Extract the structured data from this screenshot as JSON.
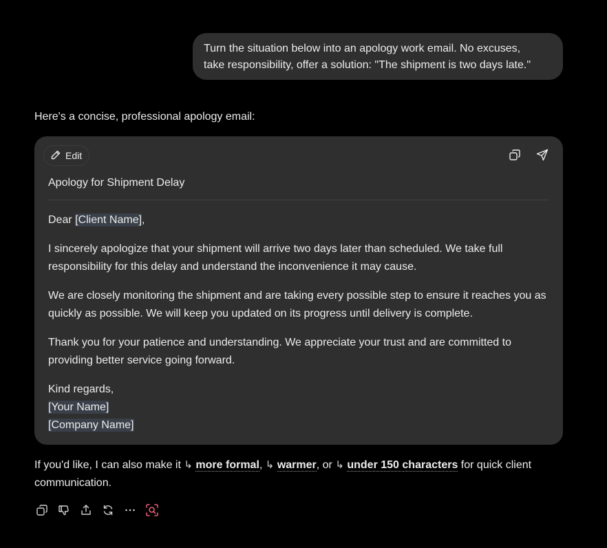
{
  "user_message": {
    "line1": "Turn the situation below into an apology work email. No excuses,",
    "line2": "take responsibility, offer a solution: \"The shipment is two days late.\""
  },
  "assistant": {
    "intro": "Here's a concise, professional apology email:",
    "email": {
      "edit_label": "Edit",
      "subject": "Apology for Shipment Delay",
      "greeting_prefix": "Dear ",
      "greeting_placeholder": "[Client Name]",
      "greeting_suffix": ",",
      "para1": "I sincerely apologize that your shipment will arrive two days later than scheduled. We take full responsibility for this delay and understand the inconvenience it may cause.",
      "para2": "We are closely monitoring the shipment and are taking every possible step to ensure it reaches you as quickly as possible. We will keep you updated on its progress until delivery is complete.",
      "para3": "Thank you for your patience and understanding. We appreciate your trust and are committed to providing better service going forward.",
      "closing": "Kind regards,",
      "name_placeholder": "[Your Name]",
      "company_placeholder": "[Company Name]"
    },
    "followup": {
      "prefix": "If you'd like, I can also make it",
      "arrow": "↳",
      "option1": "more formal",
      "sep1": ",",
      "option2": "warmer",
      "sep2": ", or",
      "option3": "under 150 characters",
      "suffix": "for quick client communication."
    }
  },
  "icons": {
    "edit": "pencil-icon",
    "copy": "copy-icon",
    "send": "send-icon",
    "actions": [
      "copy-icon",
      "thumbs-down-icon",
      "share-icon",
      "regenerate-icon",
      "more-icon",
      "search-image-icon"
    ]
  },
  "colors": {
    "background": "#000000",
    "bubble": "#2f2f2f",
    "placeholder_highlight": "#3a4049",
    "accent_icon": "#e8607a"
  }
}
